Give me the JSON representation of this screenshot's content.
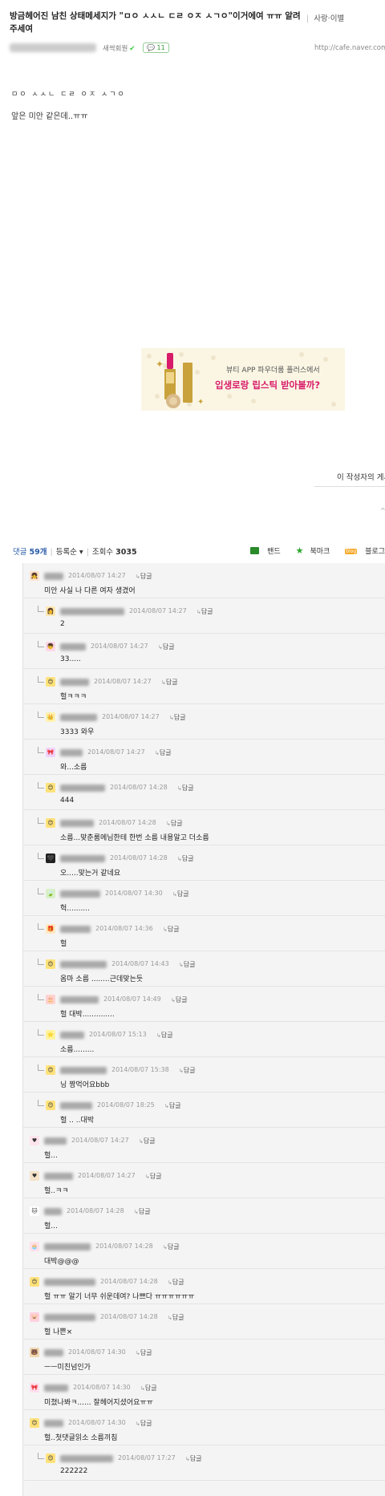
{
  "post": {
    "title": "방금헤어진 남친 상태메세지가 \"ㅁㅇ ㅅㅅㄴ ㄷㄹ ㅇㅈ ㅅㄱㅇ\"이거에여 ㅠㅠ 알려주세여",
    "board": "사랑·이별",
    "author_rank": "새싹회원",
    "comment_badge": "11",
    "url": "http://cafe.naver.com/",
    "body_line1": "ㅁㅇ ㅅㅅㄴ ㄷㄹ ㅇㅈ ㅅㄱㅇ",
    "body_line2": "앞은 미안 같은데..ㅠㅠ",
    "author_more": "이 작성자의 게시",
    "arrow": "^"
  },
  "ad": {
    "line1": "뷰티 APP 파우더룸 플러스에서",
    "line2": "입생로랑 립스틱 받아볼까?",
    "colors": {
      "bg": "#fbf6e4",
      "accent": "#d81b6a",
      "gold": "#c9a23c"
    }
  },
  "stats": {
    "comment_label": "댓글",
    "comment_count": "59개",
    "sort_label": "등록순 ▾",
    "views_label": "조회수",
    "views": "3035",
    "band_label": "밴드",
    "bookmark_label": "북마크",
    "blog_label": "블로그",
    "blog_icon_text": "blog"
  },
  "reply_label": "답글",
  "comments": [
    {
      "reply": false,
      "date": "2014/08/07 14:27",
      "text": "미안 사실 나 다른 여자 생겼어",
      "avatar": "👧",
      "avatar_bg": "#fde0c8"
    },
    {
      "reply": true,
      "date": "2014/08/07 14:27",
      "text": "2",
      "avatar": "👩",
      "avatar_bg": "#fde8b0"
    },
    {
      "reply": true,
      "date": "2014/08/07 14:27",
      "text": "33.....",
      "avatar": "👦",
      "avatar_bg": "#ffd7e8"
    },
    {
      "reply": true,
      "date": "2014/08/07 14:27",
      "text": "헐ㅋㅋㅋ",
      "avatar": "😊",
      "avatar_bg": "#ffe27a"
    },
    {
      "reply": true,
      "date": "2014/08/07 14:27",
      "text": "3333 와우",
      "avatar": "👑",
      "avatar_bg": "#fff2b0"
    },
    {
      "reply": true,
      "date": "2014/08/07 14:27",
      "text": "와...소름",
      "avatar": "🎀",
      "avatar_bg": "#eed4ff"
    },
    {
      "reply": true,
      "date": "2014/08/07 14:28",
      "text": "444",
      "avatar": "😊",
      "avatar_bg": "#ffe27a"
    },
    {
      "reply": true,
      "date": "2014/08/07 14:28",
      "text": "소름...맞춘룸메님한테 한번 소름 내용알고 더소름",
      "avatar": "😊",
      "avatar_bg": "#ffe27a"
    },
    {
      "reply": true,
      "date": "2014/08/07 14:28",
      "text": "오.....맞는거 같네요",
      "avatar": "🖤",
      "avatar_bg": "#222222"
    },
    {
      "reply": true,
      "date": "2014/08/07 14:30",
      "text": "헉..........",
      "avatar": "🍃",
      "avatar_bg": "#d8f0c8"
    },
    {
      "reply": true,
      "date": "2014/08/07 14:36",
      "text": "헐",
      "avatar": "🎁",
      "avatar_bg": "#ffe8c0"
    },
    {
      "reply": true,
      "date": "2014/08/07 14:43",
      "text": "옴마 소름 ........근데맞는듯",
      "avatar": "😊",
      "avatar_bg": "#ffe27a"
    },
    {
      "reply": true,
      "date": "2014/08/07 14:49",
      "text": "헐 대박..............",
      "avatar": "🎂",
      "avatar_bg": "#ffd0d0"
    },
    {
      "reply": true,
      "date": "2014/08/07 15:13",
      "text": "소름.........",
      "avatar": "⭐",
      "avatar_bg": "#fff3a0"
    },
    {
      "reply": true,
      "date": "2014/08/07 15:38",
      "text": "닝 짱먹어요bbb",
      "avatar": "😊",
      "avatar_bg": "#ffe27a"
    },
    {
      "reply": true,
      "date": "2014/08/07 18:25",
      "text": "헐 .. ..대박",
      "avatar": "😊",
      "avatar_bg": "#ffe27a"
    },
    {
      "reply": false,
      "date": "2014/08/07 14:27",
      "text": "헐...",
      "avatar": "♥",
      "avatar_bg": "#ffe4ec"
    },
    {
      "reply": false,
      "date": "2014/08/07 14:27",
      "text": "헐..ㅋㅋ",
      "avatar": "♥",
      "avatar_bg": "#f5e2c8"
    },
    {
      "reply": false,
      "date": "2014/08/07 14:28",
      "text": "헐...",
      "avatar": "🐱",
      "avatar_bg": "#ffffff"
    },
    {
      "reply": false,
      "date": "2014/08/07 14:28",
      "text": "대박@@@",
      "avatar": "🧁",
      "avatar_bg": "#ffe0ec"
    },
    {
      "reply": false,
      "date": "2014/08/07 14:28",
      "text": "헐 ㅠㅠ 알기 너무 쉬운데여? 나쁘다 ㅠㅠㅠㅠㅠㅠ",
      "avatar": "😊",
      "avatar_bg": "#ffe27a"
    },
    {
      "reply": false,
      "date": "2014/08/07 14:28",
      "text": "헐 나쁜×",
      "avatar": "🐷",
      "avatar_bg": "#ffd0e0"
    },
    {
      "reply": false,
      "date": "2014/08/07 14:30",
      "text": "ㅡㅡ미친넘인가",
      "avatar": "🐻",
      "avatar_bg": "#f0d8b0"
    },
    {
      "reply": false,
      "date": "2014/08/07 14:30",
      "text": "미쳤나봐ㅋ...... 잘헤어지셨어요ㅠㅠ",
      "avatar": "🎀",
      "avatar_bg": "#ffe0f0"
    },
    {
      "reply": false,
      "date": "2014/08/07 14:30",
      "text": "헐..첫댓글읽소 소름끼침",
      "avatar": "😊",
      "avatar_bg": "#ffe27a"
    },
    {
      "reply": true,
      "date": "2014/08/07 17:27",
      "text": "222222",
      "avatar": "😊",
      "avatar_bg": "#ffe27a"
    }
  ]
}
